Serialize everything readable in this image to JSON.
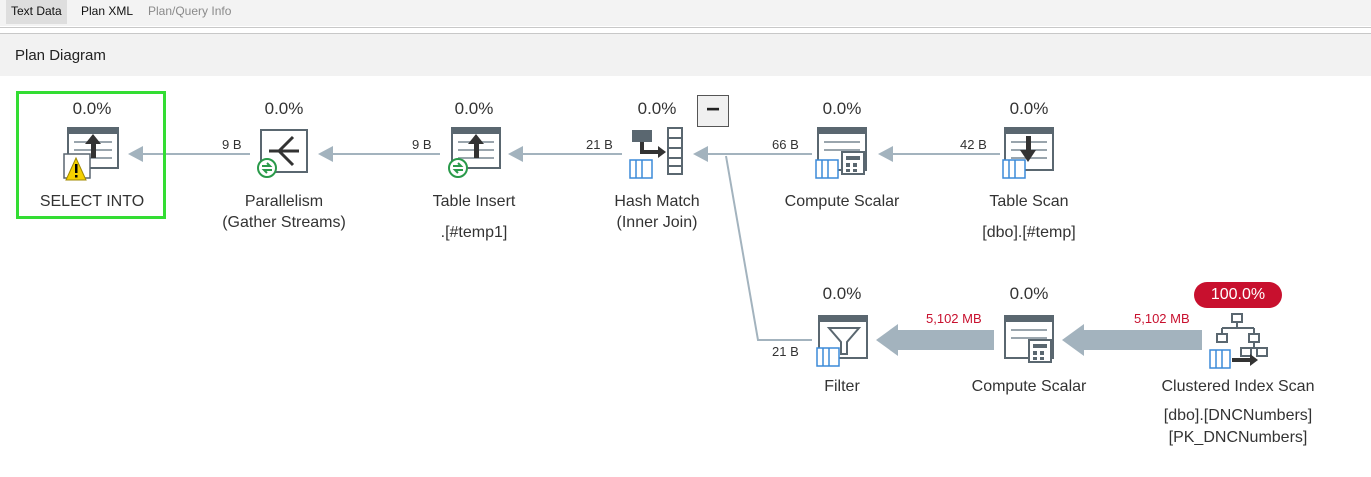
{
  "tabs": [
    {
      "label": "Text Data"
    },
    {
      "label": "Plan XML"
    },
    {
      "label": "Plan/Query Info"
    }
  ],
  "panel": {
    "title": "Plan Diagram"
  },
  "colors": {
    "selection": "#33dd33",
    "hot": "#c8102e",
    "arrow": "#a3b3be"
  },
  "nodes": {
    "select_into": {
      "pct": "0.0%",
      "name": "SELECT INTO",
      "icon": "select-into-icon",
      "warning": true
    },
    "parallelism": {
      "pct": "0.0%",
      "name": "Parallelism",
      "sub": "(Gather Streams)",
      "icon": "parallelism-icon"
    },
    "table_insert": {
      "pct": "0.0%",
      "name": "Table Insert",
      "sub": ".[#temp1]",
      "icon": "table-insert-icon"
    },
    "hash_match": {
      "pct": "0.0%",
      "name": "Hash Match",
      "sub": "(Inner Join)",
      "icon": "hash-match-icon"
    },
    "compute_scalar_1": {
      "pct": "0.0%",
      "name": "Compute Scalar",
      "icon": "compute-scalar-icon"
    },
    "table_scan": {
      "pct": "0.0%",
      "name": "Table Scan",
      "sub": "[dbo].[#temp]",
      "icon": "table-scan-icon"
    },
    "filter": {
      "pct": "0.0%",
      "name": "Filter",
      "icon": "filter-icon"
    },
    "compute_scalar_2": {
      "pct": "0.0%",
      "name": "Compute Scalar",
      "icon": "compute-scalar-icon"
    },
    "clustered_index_scan": {
      "pct": "100.0%",
      "name": "Clustered Index Scan",
      "sub": "[dbo].[DNCNumbers]",
      "sub2": "[PK_DNCNumbers]",
      "icon": "clustered-index-scan-icon"
    }
  },
  "edges": {
    "parallelism_to_select": "9 B",
    "insert_to_parallelism": "9 B",
    "hash_to_insert": "21 B",
    "compute1_to_hash": "66 B",
    "scan_to_compute1": "42 B",
    "filter_to_hash": "21 B",
    "compute2_to_filter": "5,102 MB",
    "cis_to_compute2": "5,102 MB"
  },
  "collapse_button": {
    "label": "−"
  }
}
